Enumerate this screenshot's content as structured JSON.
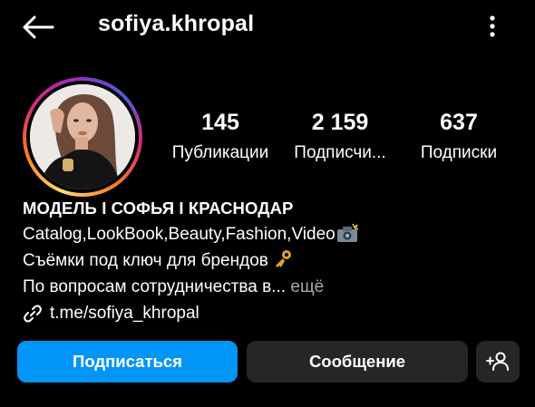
{
  "header": {
    "username": "sofiya.khropal",
    "back_icon": "arrow-left-icon",
    "more_icon": "more-vertical-icon"
  },
  "stats": [
    {
      "value": "145",
      "label": "Публикации"
    },
    {
      "value": "2 159",
      "label": "Подписчи..."
    },
    {
      "value": "637",
      "label": "Подписки"
    }
  ],
  "bio": {
    "name": "МОДЕЛЬ I СОФЬЯ I КРАСНОДАР",
    "line1": "Catalog,LookBook,Beauty,Fashion,Video",
    "line1_emoji": "camera-flash-icon",
    "line2": "Съёмки под ключ для брендов",
    "line2_emoji": "key-icon",
    "line3": "По вопросам сотрудничества в...",
    "more": "ещё",
    "link": "t.me/sofiya_khropal",
    "link_icon": "link-icon"
  },
  "actions": {
    "follow": "Подписаться",
    "message": "Сообщение",
    "add_user_icon": "add-user-icon"
  },
  "colors": {
    "background": "#000000",
    "primary_button": "#0095f6",
    "secondary_button": "#262626",
    "muted_text": "#a8a8a8"
  }
}
